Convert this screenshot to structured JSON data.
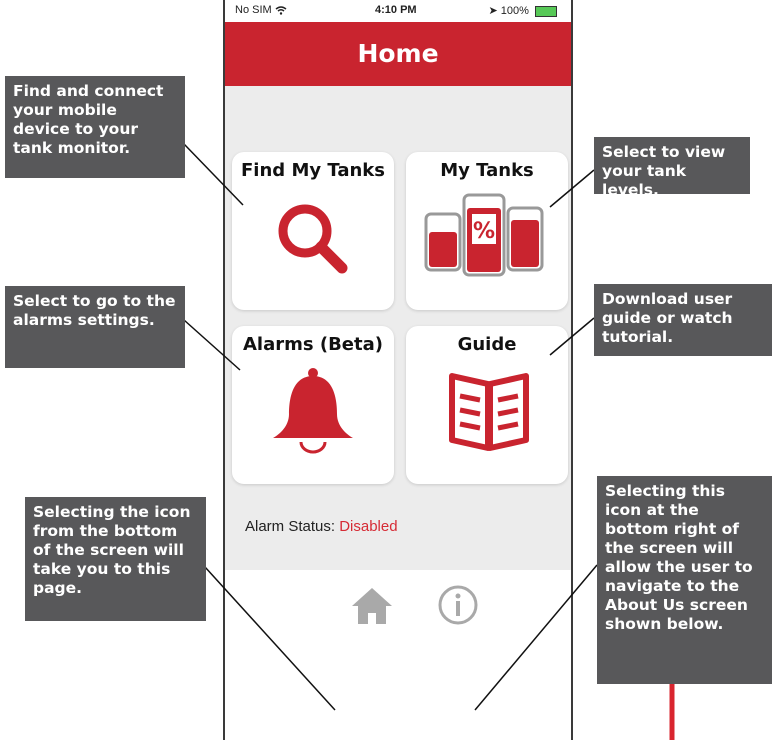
{
  "status_bar": {
    "carrier": "No SIM",
    "time": "4:10 PM",
    "battery": "100%"
  },
  "header": {
    "title": "Home"
  },
  "cards": [
    {
      "label": "Find My Tanks",
      "icon": "magnifier-icon"
    },
    {
      "label": "My Tanks",
      "icon": "tank-levels-icon",
      "icon_text": "%"
    },
    {
      "label": "Alarms (Beta)",
      "icon": "bell-icon"
    },
    {
      "label": "Guide",
      "icon": "open-book-icon"
    }
  ],
  "alarm_status": {
    "label": "Alarm Status:",
    "value": "Disabled"
  },
  "tab_bar": {
    "items": [
      {
        "icon": "home-icon"
      },
      {
        "icon": "info-icon"
      }
    ]
  },
  "callouts": {
    "find_tanks": "Find and connect your mobile device to your tank monitor.",
    "my_tanks": "Select to view your tank levels.",
    "alarms": "Select to go to the alarms settings.",
    "guide": "Download user guide or watch tutorial.",
    "home_icon": "Selecting the icon from the bottom of the screen will take you to this page.",
    "about_icon": "Selecting this icon at the bottom right of the screen will allow the user to navigate to the About Us screen shown below."
  },
  "colors": {
    "brand_red": "#c9242f",
    "callout_bg": "#58585a",
    "background": "#ececec",
    "icon_gray": "#a9a9a9"
  }
}
